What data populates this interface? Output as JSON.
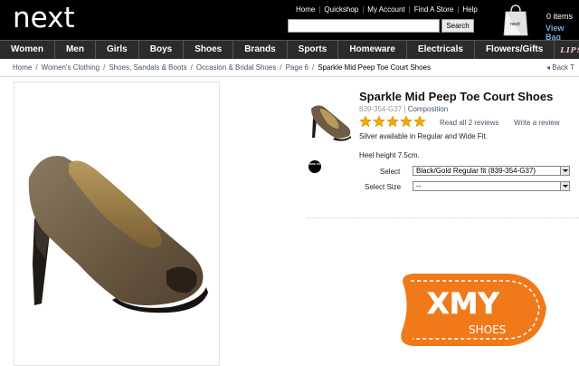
{
  "header": {
    "logo": "next",
    "top_links": [
      "Home",
      "Quickshop",
      "My Account",
      "Find A Store",
      "Help"
    ],
    "search_button": "Search",
    "search_value": "",
    "cart_items": "0 items",
    "cart_view": "View Bag",
    "bag_label": "next"
  },
  "nav": [
    "Women",
    "Men",
    "Girls",
    "Boys",
    "Shoes",
    "Brands",
    "Sports",
    "Homeware",
    "Electricals",
    "Flowers/Gifts",
    "LIPS"
  ],
  "breadcrumb": [
    "Home",
    "Women's Clothing",
    "Shoes, Sandals & Boots",
    "Occasion & Bridal Shoes",
    "Page 6"
  ],
  "breadcrumb_current": "Sparkle Mid Peep Toe Court Shoes",
  "back_link": "Back T",
  "product": {
    "title": "Sparkle Mid Peep Toe Court Shoes",
    "code": "839-354-G37",
    "composition": "Composition",
    "rating": 5,
    "read_reviews": "Read all 2 reviews",
    "write_review": "Write a review",
    "description1": "Silver available in Regular and Wide Fit.",
    "description2": "Heel height 7.5cm.",
    "badge": "WIDE FIT",
    "select_label": "Select",
    "select_value": "Black/Gold Regular fit (839-354-G37)",
    "size_label": "Select Size",
    "size_value": "--"
  },
  "watermark": {
    "brand": "XMY",
    "sub": "SHOES"
  },
  "colors": {
    "header_bg": "#000000",
    "nav_bg": "#2b2b2b",
    "link": "#445566",
    "star": "#f2a900",
    "watermark_orange": "#f07a1a"
  }
}
